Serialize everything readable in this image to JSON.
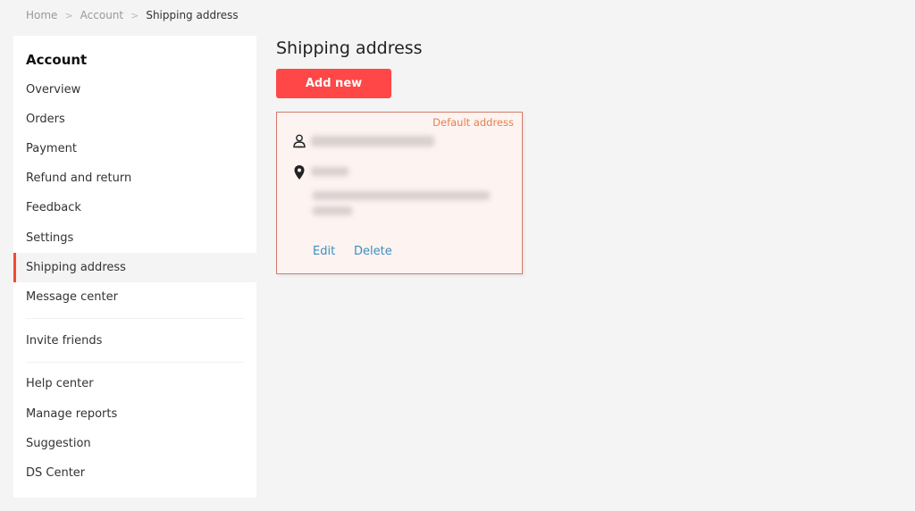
{
  "breadcrumb": {
    "items": [
      "Home",
      "Account",
      "Shipping address"
    ],
    "separator": ">"
  },
  "sidebar": {
    "title": "Account",
    "items": [
      {
        "label": "Overview"
      },
      {
        "label": "Orders"
      },
      {
        "label": "Payment"
      },
      {
        "label": "Refund and return"
      },
      {
        "label": "Feedback"
      },
      {
        "label": "Settings"
      },
      {
        "label": "Shipping address",
        "active": true
      },
      {
        "label": "Message center"
      },
      {
        "label": "Invite friends"
      },
      {
        "label": "Help center"
      },
      {
        "label": "Manage reports"
      },
      {
        "label": "Suggestion"
      },
      {
        "label": "DS Center"
      }
    ]
  },
  "main": {
    "title": "Shipping address",
    "add_button": "Add new",
    "address_card": {
      "badge": "Default address",
      "name_phone": "[blurred]",
      "address": "[blurred]",
      "edit_label": "Edit",
      "delete_label": "Delete"
    }
  },
  "colors": {
    "accent": "#ff4747",
    "active_indicator": "#f44a33",
    "card_border": "#d27a6a",
    "card_bg": "#fdf3f1",
    "default_badge": "#e8804a",
    "link": "#3a8fc0"
  }
}
